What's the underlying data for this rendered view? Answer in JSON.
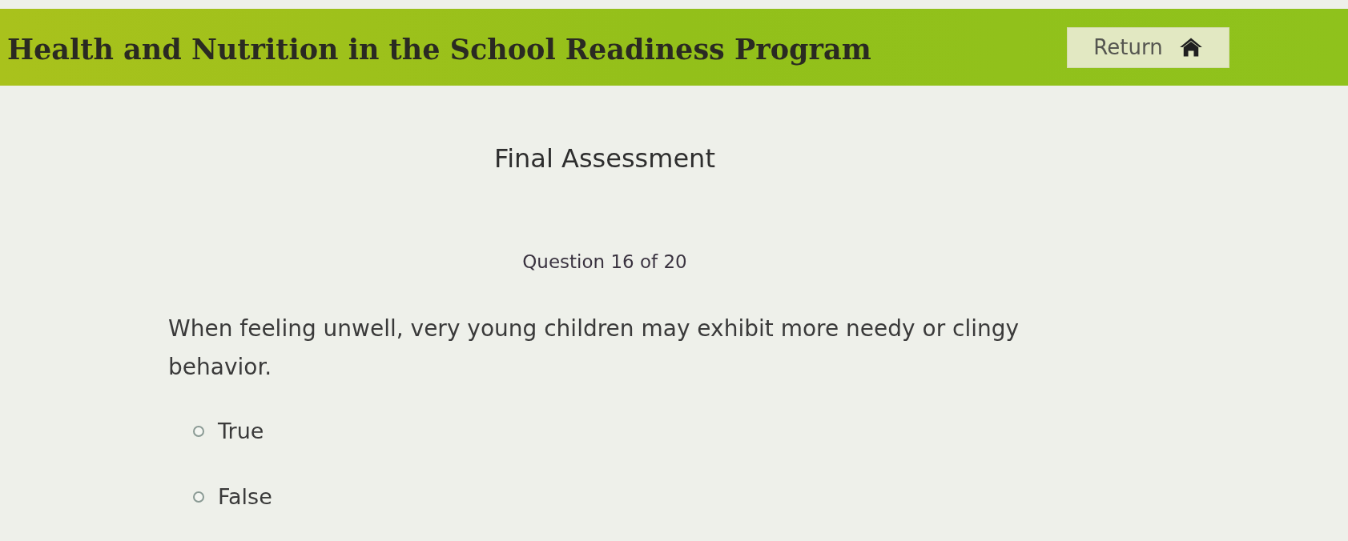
{
  "header": {
    "title": "Health and Nutrition in the School Readiness Program",
    "return_button": {
      "label": "Return"
    }
  },
  "assessment": {
    "title": "Final Assessment",
    "progress": "Question 16 of 20",
    "question": "When feeling unwell, very young children may exhibit more needy or clingy behavior.",
    "options": [
      {
        "label": "True",
        "selected": false
      },
      {
        "label": "False",
        "selected": false
      }
    ]
  }
}
